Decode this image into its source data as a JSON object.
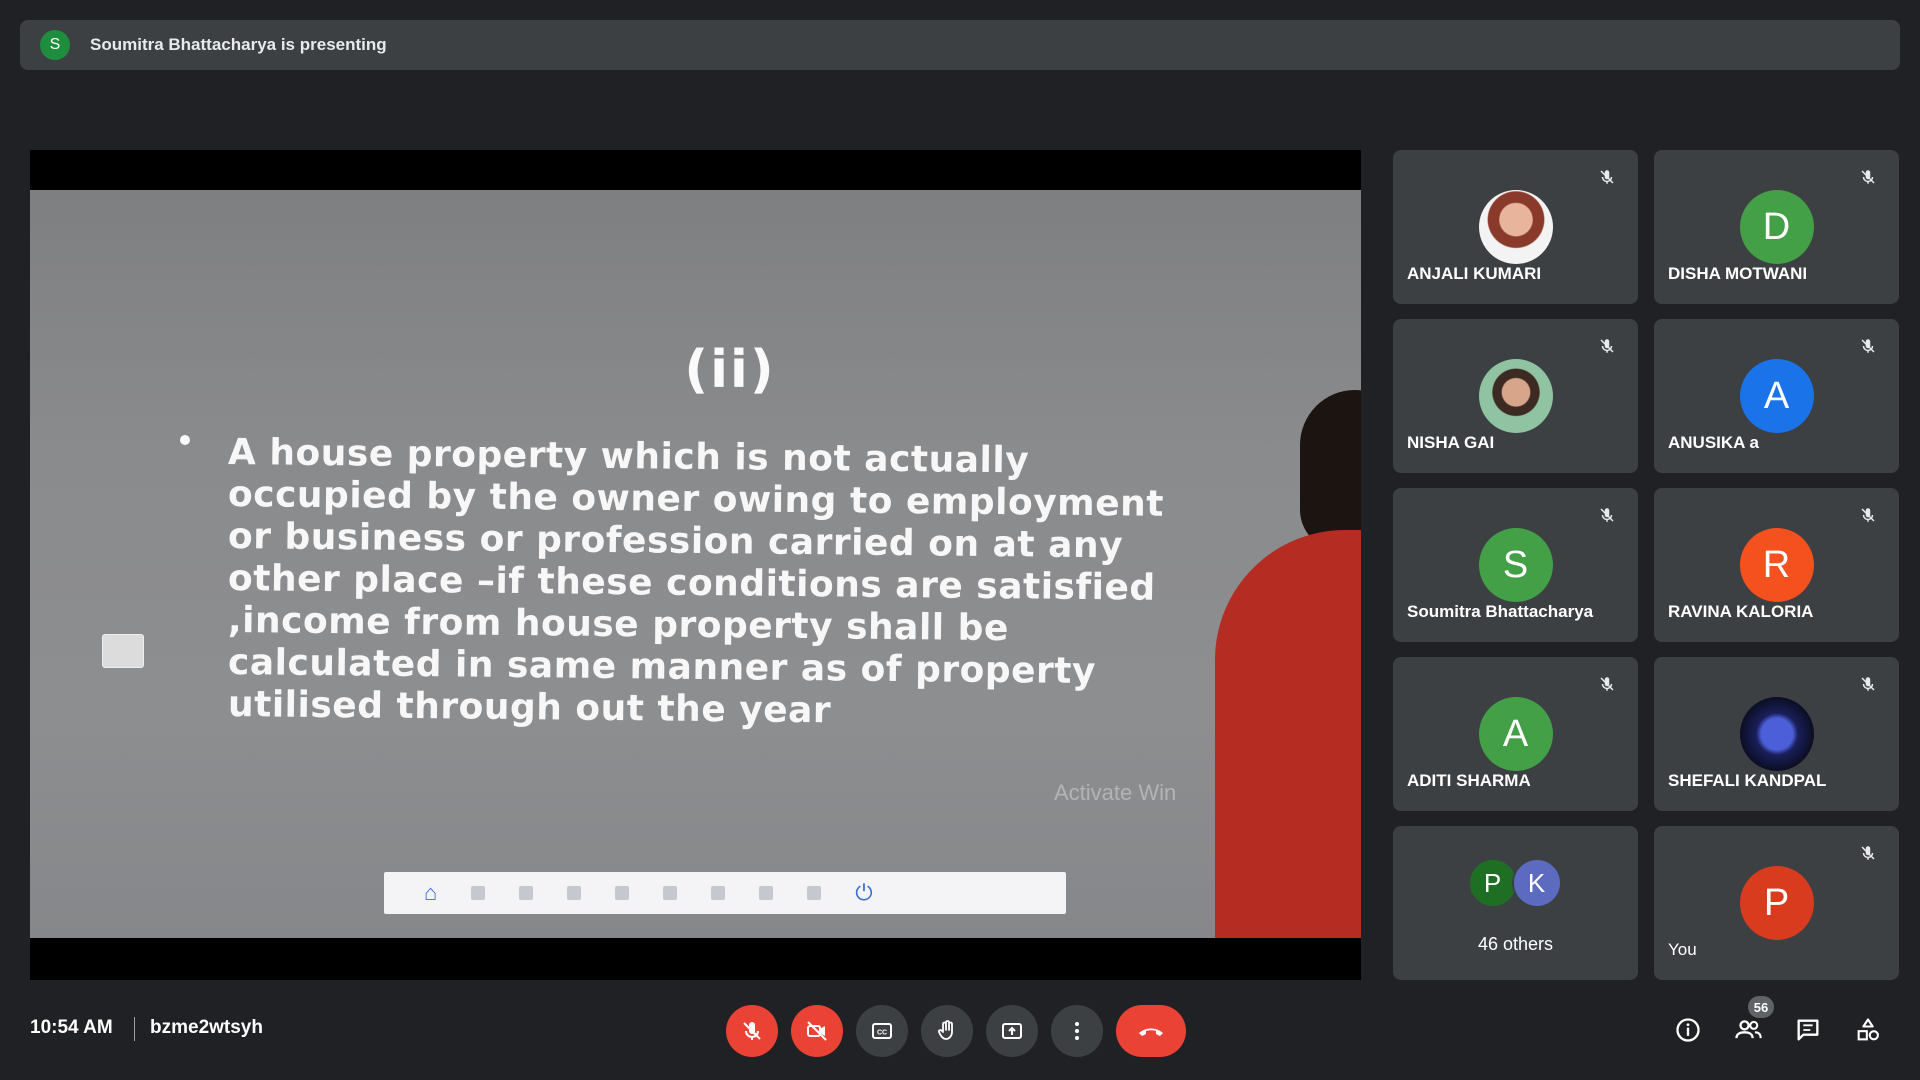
{
  "banner": {
    "presenter_initial": "S",
    "presenting_text": "Soumitra Bhattacharya is presenting"
  },
  "slide": {
    "heading": "(ii)",
    "lines": [
      "A house property which is not actually",
      "occupied by the owner owing to employment",
      "or business or profession carried on at any",
      "other place –if these conditions are satisfied",
      ",income from house property shall be",
      "calculated in same manner as of property",
      "utilised through out the year"
    ],
    "watermark": "Activate Win"
  },
  "participants": [
    {
      "name": "ANJALI KUMARI",
      "initial": "",
      "color": "",
      "photo": "photo-a",
      "muted": true
    },
    {
      "name": "DISHA MOTWANI",
      "initial": "D",
      "color": "#43a047",
      "photo": "",
      "muted": true
    },
    {
      "name": "NISHA GAI",
      "initial": "",
      "color": "",
      "photo": "photo-n",
      "muted": true
    },
    {
      "name": "ANUSIKA a",
      "initial": "A",
      "color": "#1a73e8",
      "photo": "",
      "muted": true
    },
    {
      "name": "Soumitra Bhattacharya",
      "initial": "S",
      "color": "#43a047",
      "photo": "",
      "muted": true
    },
    {
      "name": "RAVINA KALORIA",
      "initial": "R",
      "color": "#f4511e",
      "photo": "",
      "muted": true
    },
    {
      "name": "ADITI SHARMA",
      "initial": "A",
      "color": "#43a047",
      "photo": "",
      "muted": true
    },
    {
      "name": "SHEFALI KANDPAL",
      "initial": "",
      "color": "",
      "photo": "photo-s",
      "muted": true
    }
  ],
  "others_tile": {
    "avatars": [
      {
        "initial": "P",
        "color": "#1e6f24"
      },
      {
        "initial": "K",
        "color": "#5c6bc0"
      }
    ],
    "label": "46 others"
  },
  "self_tile": {
    "name": "You",
    "initial": "P",
    "color": "#d93b1f",
    "muted": true
  },
  "bottom_bar": {
    "time": "10:54 AM",
    "meeting_code": "bzme2wtsyh",
    "people_count": "56",
    "controls": [
      "mic-off",
      "camera-off",
      "captions",
      "raise-hand",
      "present",
      "more-options",
      "leave-call"
    ],
    "right_controls": [
      "meeting-details",
      "people",
      "chat",
      "activities"
    ]
  },
  "colors": {
    "background": "#202124",
    "surface": "#3c4043",
    "danger": "#ea4335"
  }
}
